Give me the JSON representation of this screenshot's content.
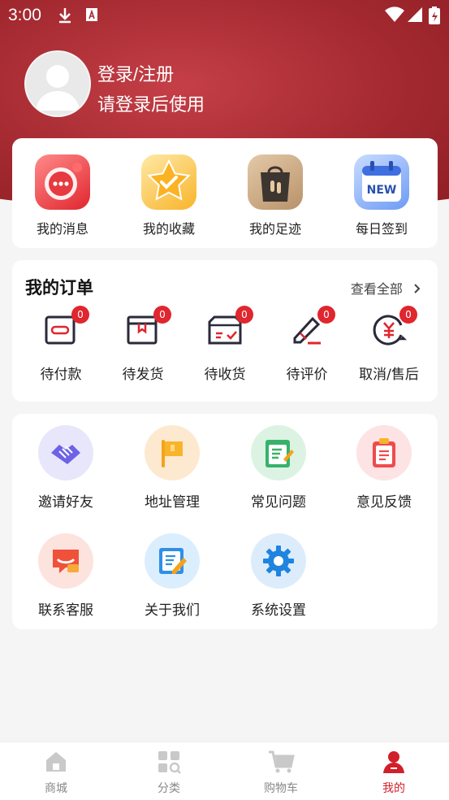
{
  "status_bar": {
    "time": "3:00"
  },
  "profile": {
    "title": "登录/注册",
    "subtitle": "请登录后使用"
  },
  "quick_links": [
    {
      "label": "我的消息",
      "icon": "message-icon"
    },
    {
      "label": "我的收藏",
      "icon": "favorite-star-icon"
    },
    {
      "label": "我的足迹",
      "icon": "footprint-bag-icon"
    },
    {
      "label": "每日签到",
      "icon": "new-calendar-icon"
    }
  ],
  "orders": {
    "title": "我的订单",
    "view_all": "查看全部",
    "items": [
      {
        "label": "待付款",
        "count": "0"
      },
      {
        "label": "待发货",
        "count": "0"
      },
      {
        "label": "待收货",
        "count": "0"
      },
      {
        "label": "待评价",
        "count": "0"
      },
      {
        "label": "取消/售后",
        "count": "0"
      }
    ]
  },
  "tools": [
    {
      "label": "邀请好友",
      "icon": "handshake-icon"
    },
    {
      "label": "地址管理",
      "icon": "flag-icon"
    },
    {
      "label": "常见问题",
      "icon": "notebook-icon"
    },
    {
      "label": "意见反馈",
      "icon": "clipboard-icon"
    },
    {
      "label": "联系客服",
      "icon": "chat-bubble-icon"
    },
    {
      "label": "关于我们",
      "icon": "edit-note-icon"
    },
    {
      "label": "系统设置",
      "icon": "gear-icon"
    }
  ],
  "tabbar": [
    {
      "label": "商城"
    },
    {
      "label": "分类"
    },
    {
      "label": "购物车"
    },
    {
      "label": "我的",
      "active": true
    }
  ],
  "colors": {
    "primary": "#d21f2a",
    "header": "#a52a31",
    "badge": "#e0262e"
  }
}
